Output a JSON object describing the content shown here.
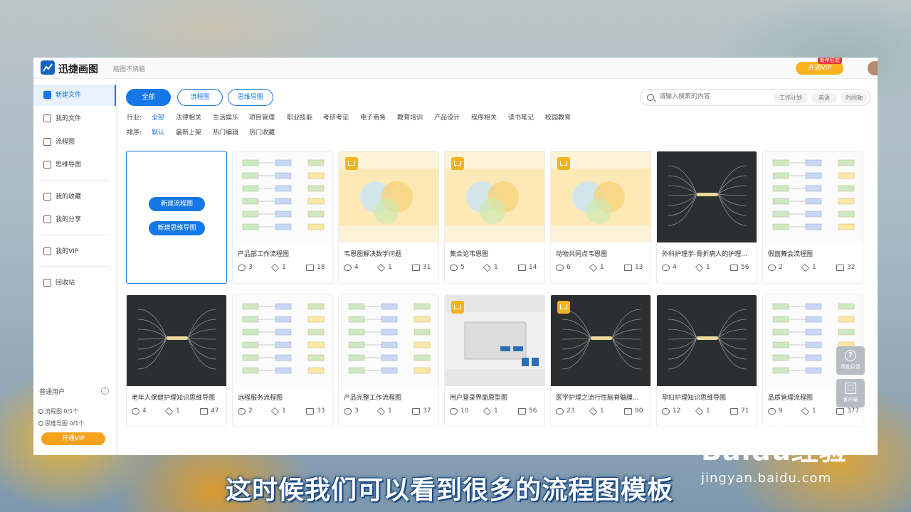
{
  "app": {
    "name": "迅捷画图",
    "slogan": "脑图不烧脑",
    "vip_button": "开通VIP",
    "vip_badge": "新年狂欢"
  },
  "sidebar": {
    "items": [
      {
        "label": "新建文件",
        "icon": "plus-icon"
      },
      {
        "label": "我的文件",
        "icon": "file-icon"
      },
      {
        "label": "流程图",
        "icon": "flowchart-icon"
      },
      {
        "label": "思维导图",
        "icon": "mindmap-icon"
      },
      {
        "label": "我的收藏",
        "icon": "folder-star-icon"
      },
      {
        "label": "我的分享",
        "icon": "share-icon"
      },
      {
        "label": "我的VIP",
        "icon": "vip-icon"
      },
      {
        "label": "回收站",
        "icon": "trash-icon"
      }
    ],
    "user_type": "普通用户",
    "quota_flow": "流程图 0/1个",
    "quota_mind": "思维导图 0/1个",
    "vip_button": "开通VIP"
  },
  "filters": {
    "type_tabs": [
      "全部",
      "流程图",
      "思维导图"
    ],
    "search_placeholder": "请输入搜索的内容",
    "search_tags": [
      "工作计划",
      "英语",
      "时间轴"
    ],
    "industry_label": "行业:",
    "industries": [
      "全部",
      "法律相关",
      "生活娱乐",
      "项目管理",
      "职业技能",
      "考研考证",
      "电子商务",
      "教育培训",
      "产品设计",
      "程序相关",
      "读书笔记",
      "校园教育"
    ],
    "sort_label": "排序:",
    "sorts": [
      "默认",
      "最新上架",
      "热门编辑",
      "热门收藏"
    ]
  },
  "new_card": {
    "btn_flow": "新建流程图",
    "btn_mind": "新建思维导图"
  },
  "templates": [
    {
      "title": "产品部工作流程图",
      "views": "3",
      "stars": "1",
      "edits": "18",
      "vip": false,
      "style": "light"
    },
    {
      "title": "韦恩图解决数学问题",
      "views": "4",
      "stars": "1",
      "edits": "31",
      "vip": true,
      "style": "yellow"
    },
    {
      "title": "集合论韦恩图",
      "views": "5",
      "stars": "1",
      "edits": "14",
      "vip": true,
      "style": "yellow"
    },
    {
      "title": "动物共同点韦恩图",
      "views": "6",
      "stars": "1",
      "edits": "13",
      "vip": true,
      "style": "yellow"
    },
    {
      "title": "外科护理学-骨折病人的护理...",
      "views": "4",
      "stars": "1",
      "edits": "56",
      "vip": false,
      "style": "dark"
    },
    {
      "title": "假面舞会流程图",
      "views": "2",
      "stars": "1",
      "edits": "32",
      "vip": false,
      "style": "light"
    },
    {
      "title": "老年人保健护理知识思维导图",
      "views": "4",
      "stars": "1",
      "edits": "47",
      "vip": false,
      "style": "dark"
    },
    {
      "title": "远程服务流程图",
      "views": "2",
      "stars": "1",
      "edits": "33",
      "vip": false,
      "style": "light"
    },
    {
      "title": "产品完整工作流程图",
      "views": "3",
      "stars": "1",
      "edits": "37",
      "vip": false,
      "style": "light"
    },
    {
      "title": "用户登录界面原型图",
      "views": "10",
      "stars": "1",
      "edits": "56",
      "vip": true,
      "style": "grey"
    },
    {
      "title": "医学护理之流行性脑脊髓膜...",
      "views": "23",
      "stars": "1",
      "edits": "90",
      "vip": true,
      "style": "dark"
    },
    {
      "title": "孕妇护理知识思维导图",
      "views": "12",
      "stars": "1",
      "edits": "71",
      "vip": false,
      "style": "dark"
    },
    {
      "title": "品质管理流程图",
      "views": "9",
      "stars": "1",
      "edits": "377",
      "vip": false,
      "style": "light"
    }
  ],
  "float_buttons": {
    "feedback": "帮助反馈",
    "client": "客户端"
  },
  "caption": "这时候我们可以看到很多的流程图模板",
  "watermark": {
    "brand": "Baidu经验",
    "url": "jingyan.baidu.com"
  }
}
